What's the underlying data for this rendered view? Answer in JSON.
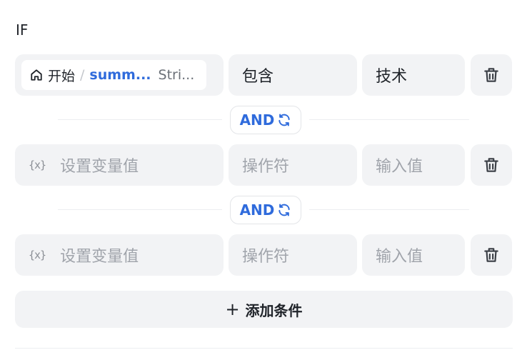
{
  "header": {
    "label": "IF"
  },
  "conditions": [
    {
      "variable": {
        "source": "开始",
        "separator": "/",
        "name": "summ...",
        "type": "Stri..."
      },
      "operator": "包含",
      "value": "技术"
    },
    {
      "variable_placeholder": "设置变量值",
      "variable_icon": "{x}",
      "operator_placeholder": "操作符",
      "value_placeholder": "输入值"
    },
    {
      "variable_placeholder": "设置变量值",
      "variable_icon": "{x}",
      "operator_placeholder": "操作符",
      "value_placeholder": "输入值"
    }
  ],
  "connectors": [
    {
      "label": "AND"
    },
    {
      "label": "AND"
    }
  ],
  "add_condition": {
    "icon": "+",
    "label": "添加条件"
  },
  "colors": {
    "accent": "#2f6bdc",
    "field_bg": "#f2f3f5",
    "placeholder": "#a0a4ab"
  }
}
